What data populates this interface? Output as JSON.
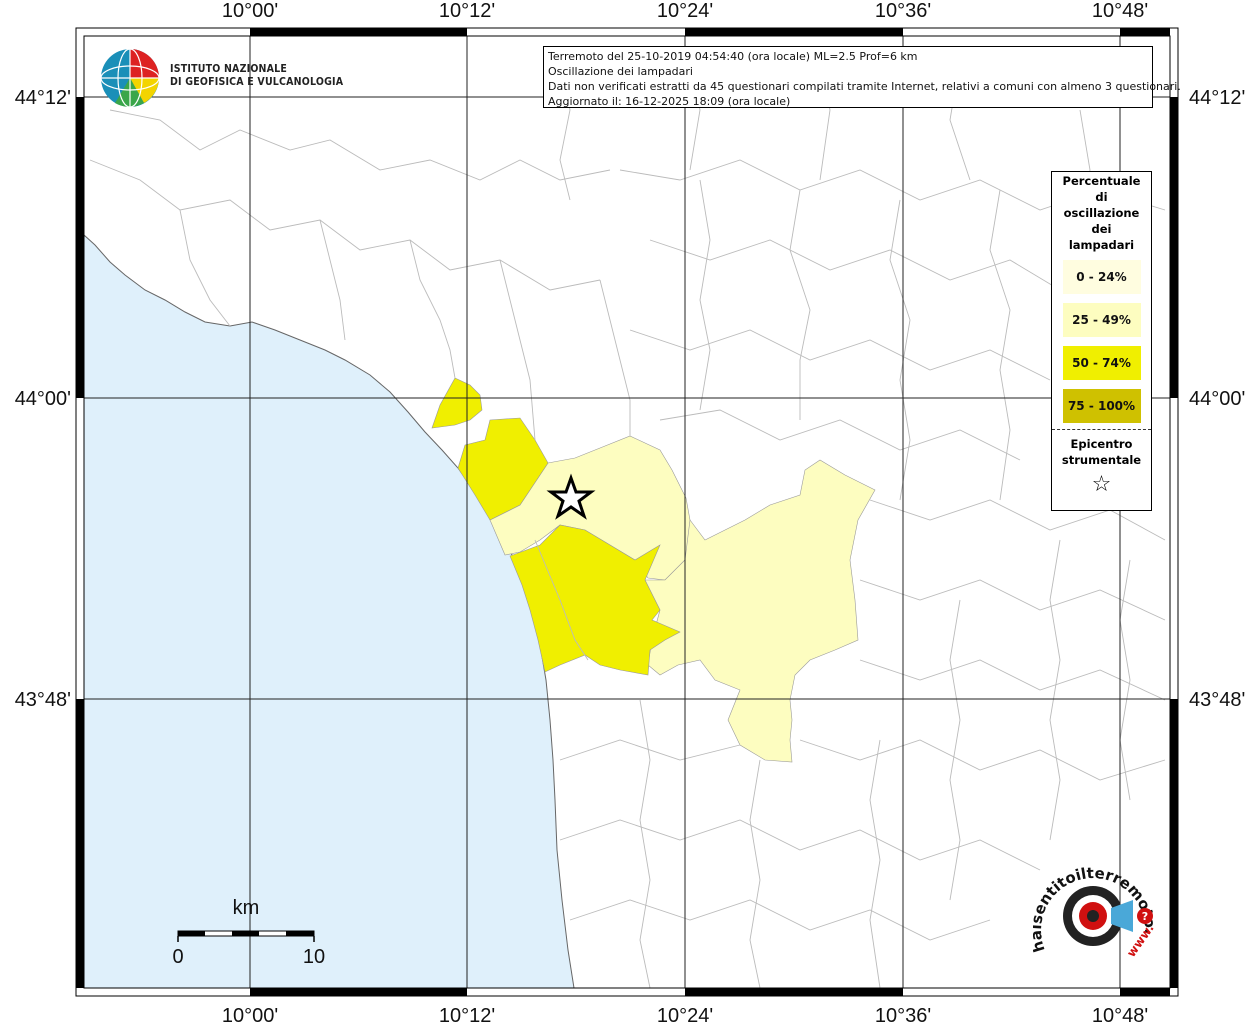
{
  "info": {
    "line1": "Terremoto del 25-10-2019 04:54:40 (ora locale) ML=2.5 Prof=6 km",
    "line2": "Oscillazione dei lampadari",
    "line3": "Dati non verificati estratti da 45 questionari compilati tramite Internet, relativi a comuni con almeno 3 questionari.",
    "line4": "Aggiornato il: 16-12-2025 18:09 (ora locale)"
  },
  "institute": {
    "line1": "ISTITUTO NAZIONALE",
    "line2": "DI GEOFISICA E VULCANOLOGIA"
  },
  "axes": {
    "lon_ticks": [
      "10°00'",
      "10°12'",
      "10°24'",
      "10°36'",
      "10°48'"
    ],
    "lat_ticks": [
      "44°12'",
      "44°00'",
      "43°48'"
    ]
  },
  "legend": {
    "title_lines": [
      "Percentuale",
      "di",
      "oscillazione",
      "dei",
      "lampadari"
    ],
    "items": [
      {
        "label": "0 - 24%",
        "color": "#fffde0"
      },
      {
        "label": "25 - 49%",
        "color": "#fdfdc0"
      },
      {
        "label": "50 - 74%",
        "color": "#f0ef00"
      },
      {
        "label": "75 - 100%",
        "color": "#cfc100"
      }
    ],
    "epicenter_lines": [
      "Epicentro",
      "strumentale"
    ],
    "epicenter_symbol": "☆"
  },
  "scale": {
    "unit": "km",
    "min": "0",
    "max": "10"
  },
  "colors": {
    "sea": "#dff0fb",
    "land": "#ffffff",
    "boundary": "#b5b5b5",
    "coast": "#666666",
    "class_25_49": "#fdfdc0",
    "class_50_74": "#f0ef00"
  },
  "logo_hst": {
    "text": "haisentitoilterremoto.it",
    "url": "www."
  }
}
